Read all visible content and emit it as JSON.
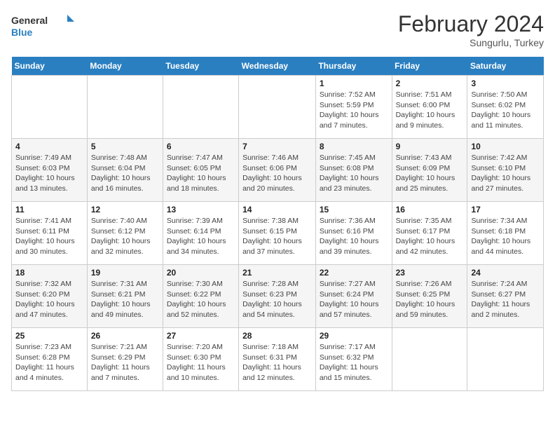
{
  "logo": {
    "line1": "General",
    "line2": "Blue"
  },
  "title": "February 2024",
  "location": "Sungurlu, Turkey",
  "days_of_week": [
    "Sunday",
    "Monday",
    "Tuesday",
    "Wednesday",
    "Thursday",
    "Friday",
    "Saturday"
  ],
  "weeks": [
    [
      {
        "day": "",
        "info": ""
      },
      {
        "day": "",
        "info": ""
      },
      {
        "day": "",
        "info": ""
      },
      {
        "day": "",
        "info": ""
      },
      {
        "day": "1",
        "info": "Sunrise: 7:52 AM\nSunset: 5:59 PM\nDaylight: 10 hours and 7 minutes."
      },
      {
        "day": "2",
        "info": "Sunrise: 7:51 AM\nSunset: 6:00 PM\nDaylight: 10 hours and 9 minutes."
      },
      {
        "day": "3",
        "info": "Sunrise: 7:50 AM\nSunset: 6:02 PM\nDaylight: 10 hours and 11 minutes."
      }
    ],
    [
      {
        "day": "4",
        "info": "Sunrise: 7:49 AM\nSunset: 6:03 PM\nDaylight: 10 hours and 13 minutes."
      },
      {
        "day": "5",
        "info": "Sunrise: 7:48 AM\nSunset: 6:04 PM\nDaylight: 10 hours and 16 minutes."
      },
      {
        "day": "6",
        "info": "Sunrise: 7:47 AM\nSunset: 6:05 PM\nDaylight: 10 hours and 18 minutes."
      },
      {
        "day": "7",
        "info": "Sunrise: 7:46 AM\nSunset: 6:06 PM\nDaylight: 10 hours and 20 minutes."
      },
      {
        "day": "8",
        "info": "Sunrise: 7:45 AM\nSunset: 6:08 PM\nDaylight: 10 hours and 23 minutes."
      },
      {
        "day": "9",
        "info": "Sunrise: 7:43 AM\nSunset: 6:09 PM\nDaylight: 10 hours and 25 minutes."
      },
      {
        "day": "10",
        "info": "Sunrise: 7:42 AM\nSunset: 6:10 PM\nDaylight: 10 hours and 27 minutes."
      }
    ],
    [
      {
        "day": "11",
        "info": "Sunrise: 7:41 AM\nSunset: 6:11 PM\nDaylight: 10 hours and 30 minutes."
      },
      {
        "day": "12",
        "info": "Sunrise: 7:40 AM\nSunset: 6:12 PM\nDaylight: 10 hours and 32 minutes."
      },
      {
        "day": "13",
        "info": "Sunrise: 7:39 AM\nSunset: 6:14 PM\nDaylight: 10 hours and 34 minutes."
      },
      {
        "day": "14",
        "info": "Sunrise: 7:38 AM\nSunset: 6:15 PM\nDaylight: 10 hours and 37 minutes."
      },
      {
        "day": "15",
        "info": "Sunrise: 7:36 AM\nSunset: 6:16 PM\nDaylight: 10 hours and 39 minutes."
      },
      {
        "day": "16",
        "info": "Sunrise: 7:35 AM\nSunset: 6:17 PM\nDaylight: 10 hours and 42 minutes."
      },
      {
        "day": "17",
        "info": "Sunrise: 7:34 AM\nSunset: 6:18 PM\nDaylight: 10 hours and 44 minutes."
      }
    ],
    [
      {
        "day": "18",
        "info": "Sunrise: 7:32 AM\nSunset: 6:20 PM\nDaylight: 10 hours and 47 minutes."
      },
      {
        "day": "19",
        "info": "Sunrise: 7:31 AM\nSunset: 6:21 PM\nDaylight: 10 hours and 49 minutes."
      },
      {
        "day": "20",
        "info": "Sunrise: 7:30 AM\nSunset: 6:22 PM\nDaylight: 10 hours and 52 minutes."
      },
      {
        "day": "21",
        "info": "Sunrise: 7:28 AM\nSunset: 6:23 PM\nDaylight: 10 hours and 54 minutes."
      },
      {
        "day": "22",
        "info": "Sunrise: 7:27 AM\nSunset: 6:24 PM\nDaylight: 10 hours and 57 minutes."
      },
      {
        "day": "23",
        "info": "Sunrise: 7:26 AM\nSunset: 6:25 PM\nDaylight: 10 hours and 59 minutes."
      },
      {
        "day": "24",
        "info": "Sunrise: 7:24 AM\nSunset: 6:27 PM\nDaylight: 11 hours and 2 minutes."
      }
    ],
    [
      {
        "day": "25",
        "info": "Sunrise: 7:23 AM\nSunset: 6:28 PM\nDaylight: 11 hours and 4 minutes."
      },
      {
        "day": "26",
        "info": "Sunrise: 7:21 AM\nSunset: 6:29 PM\nDaylight: 11 hours and 7 minutes."
      },
      {
        "day": "27",
        "info": "Sunrise: 7:20 AM\nSunset: 6:30 PM\nDaylight: 11 hours and 10 minutes."
      },
      {
        "day": "28",
        "info": "Sunrise: 7:18 AM\nSunset: 6:31 PM\nDaylight: 11 hours and 12 minutes."
      },
      {
        "day": "29",
        "info": "Sunrise: 7:17 AM\nSunset: 6:32 PM\nDaylight: 11 hours and 15 minutes."
      },
      {
        "day": "",
        "info": ""
      },
      {
        "day": "",
        "info": ""
      }
    ]
  ]
}
